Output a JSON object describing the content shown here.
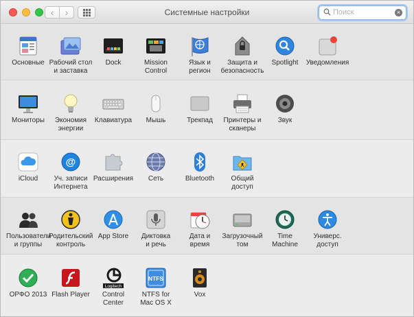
{
  "window": {
    "title": "Системные настройки"
  },
  "search": {
    "placeholder": "Поиск"
  },
  "sections": [
    {
      "items": [
        {
          "label": "Основные",
          "icon": "general-icon"
        },
        {
          "label": "Рабочий стол\nи заставка",
          "icon": "desktop-icon"
        },
        {
          "label": "Dock",
          "icon": "dock-icon"
        },
        {
          "label": "Mission\nControl",
          "icon": "mission-control-icon"
        },
        {
          "label": "Язык и\nрегион",
          "icon": "language-icon"
        },
        {
          "label": "Защита и\nбезопасность",
          "icon": "security-icon"
        },
        {
          "label": "Spotlight",
          "icon": "spotlight-icon"
        },
        {
          "label": "Уведомления",
          "icon": "notifications-icon"
        }
      ]
    },
    {
      "items": [
        {
          "label": "Мониторы",
          "icon": "displays-icon"
        },
        {
          "label": "Экономия\nэнергии",
          "icon": "energy-icon"
        },
        {
          "label": "Клавиатура",
          "icon": "keyboard-icon"
        },
        {
          "label": "Мышь",
          "icon": "mouse-icon"
        },
        {
          "label": "Трекпад",
          "icon": "trackpad-icon"
        },
        {
          "label": "Принтеры и\nсканеры",
          "icon": "printer-icon"
        },
        {
          "label": "Звук",
          "icon": "sound-icon"
        }
      ]
    },
    {
      "items": [
        {
          "label": "iCloud",
          "icon": "icloud-icon"
        },
        {
          "label": "Уч. записи\nИнтернета",
          "icon": "internet-accounts-icon"
        },
        {
          "label": "Расширения",
          "icon": "extensions-icon"
        },
        {
          "label": "Сеть",
          "icon": "network-icon"
        },
        {
          "label": "Bluetooth",
          "icon": "bluetooth-icon"
        },
        {
          "label": "Общий\nдоступ",
          "icon": "sharing-icon"
        }
      ]
    },
    {
      "items": [
        {
          "label": "Пользователи\nи группы",
          "icon": "users-icon"
        },
        {
          "label": "Родительский\nконтроль",
          "icon": "parental-icon"
        },
        {
          "label": "App Store",
          "icon": "appstore-icon"
        },
        {
          "label": "Диктовка\nи речь",
          "icon": "dictation-icon"
        },
        {
          "label": "Дата и\nвремя",
          "icon": "datetime-icon"
        },
        {
          "label": "Загрузочный\nтом",
          "icon": "startup-disk-icon"
        },
        {
          "label": "Time\nMachine",
          "icon": "time-machine-icon"
        },
        {
          "label": "Универс.\nдоступ",
          "icon": "accessibility-icon"
        }
      ]
    },
    {
      "items": [
        {
          "label": "ОРФО 2013",
          "icon": "orfo-icon"
        },
        {
          "label": "Flash Player",
          "icon": "flash-icon"
        },
        {
          "label": "Control Center",
          "icon": "logitech-icon",
          "badge": "Logitech"
        },
        {
          "label": "NTFS for\nMac OS X",
          "icon": "ntfs-icon",
          "badge": "NTFS"
        },
        {
          "label": "Vox",
          "icon": "vox-icon"
        }
      ]
    }
  ]
}
